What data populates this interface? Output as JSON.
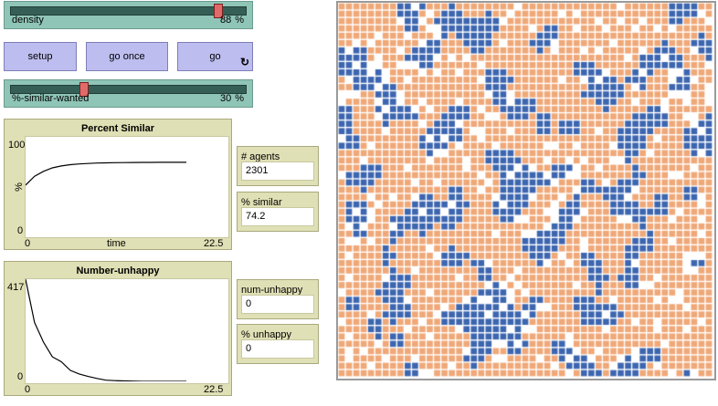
{
  "colors": {
    "turtle_a": "#3d66b0",
    "turtle_b": "#f0a878",
    "empty": "#ffffff"
  },
  "sliders": {
    "density": {
      "label": "density",
      "value": "88",
      "unit": "%",
      "fraction": 0.88
    },
    "similar": {
      "label": "%-similar-wanted",
      "value": "30",
      "unit": "%",
      "fraction": 0.3
    }
  },
  "buttons": {
    "setup": "setup",
    "go_once": "go once",
    "go": "go",
    "forever_icon": "forever-loop-icon"
  },
  "plots": {
    "percent_similar": {
      "title": "Percent Similar",
      "ylabel": "%",
      "xlabel": "time",
      "y_max": "100",
      "y_min": "0",
      "x_min": "0",
      "x_max": "22.5"
    },
    "number_unhappy": {
      "title": "Number-unhappy",
      "y_max": "417",
      "y_min": "0",
      "x_min": "0",
      "x_max": "22.5"
    }
  },
  "chart_data": [
    {
      "type": "line",
      "title": "Percent Similar",
      "xlabel": "time",
      "ylabel": "%",
      "xlim": [
        0,
        22.5
      ],
      "ylim": [
        0,
        100
      ],
      "series": [
        {
          "x": [
            0,
            1,
            2,
            3,
            4,
            5,
            6,
            7,
            8,
            9,
            10,
            11,
            12,
            13,
            14,
            15,
            16,
            17,
            18
          ],
          "values": [
            51,
            60,
            65,
            68.5,
            70.5,
            71.8,
            72.5,
            73,
            73.4,
            73.6,
            73.8,
            73.9,
            74,
            74.1,
            74.1,
            74.2,
            74.2,
            74.2,
            74.2
          ]
        }
      ]
    },
    {
      "type": "line",
      "title": "Number-unhappy",
      "xlim": [
        0,
        22.5
      ],
      "ylim": [
        0,
        417
      ],
      "series": [
        {
          "x": [
            0,
            1,
            2,
            3,
            4,
            5,
            6,
            7,
            8,
            9,
            10,
            11,
            12,
            13,
            14,
            15,
            16,
            17,
            18
          ],
          "values": [
            417,
            240,
            160,
            100,
            80,
            45,
            30,
            20,
            12,
            5,
            3,
            2,
            1,
            0,
            0,
            0,
            0,
            0,
            0
          ]
        }
      ]
    }
  ],
  "monitors": {
    "agents": {
      "label": "# agents",
      "value": "2301"
    },
    "similar": {
      "label": "% similar",
      "value": "74.2"
    },
    "num_unhappy": {
      "label": "num-unhappy",
      "value": "0"
    },
    "pct_unhappy": {
      "label": "% unhappy",
      "value": "0"
    }
  }
}
